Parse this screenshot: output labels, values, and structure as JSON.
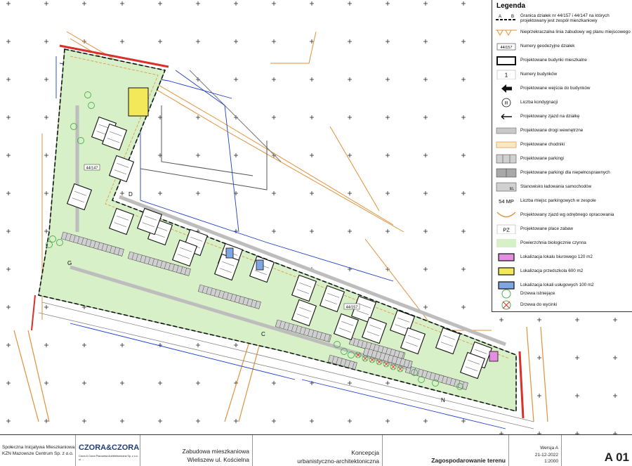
{
  "legend": {
    "title": "Legenda",
    "boundary_symbol_labels": [
      "A",
      "B"
    ],
    "parcel_number_sample": "44/157",
    "building_number_sample": "1",
    "storey_symbol_sample": "III",
    "charging_symbol_sample": "EL",
    "parking_count_sample": "54 MP",
    "playground_symbol_sample": "PZ",
    "items": [
      {
        "label": "Granica działek nr 44/157 i 44/147 na których projektowany jest zespół mieszkaniowy",
        "symbol": "boundary"
      },
      {
        "label": "Nieprzekraczalna linia zabudowy wg planu miejscowego",
        "symbol": "building-line"
      },
      {
        "label": "Numery geodezyjne działek",
        "symbol": "parcel-number"
      },
      {
        "label": "Projektowane budynki mieszkalne",
        "symbol": "building"
      },
      {
        "label": "Numery budynków",
        "symbol": "building-number"
      },
      {
        "label": "Projektowane wejścia do budynków",
        "symbol": "entrance-arrow"
      },
      {
        "label": "Liczba kondygnacji",
        "symbol": "storey-circle"
      },
      {
        "label": "Projektowany zjazd na działkę",
        "symbol": "access-arrow"
      },
      {
        "label": "Projektowane drogi wewnętrzne",
        "symbol": "road"
      },
      {
        "label": "Projektowane chodniki",
        "symbol": "sidewalk"
      },
      {
        "label": "Projektowane parkingi",
        "symbol": "parking"
      },
      {
        "label": "Projektowane parkingi dla niepełnosprawnych",
        "symbol": "parking-disabled"
      },
      {
        "label": "Stanowisko ładowania samochodów",
        "symbol": "charging"
      },
      {
        "label": "Liczba miejsc parkingowych w zespole",
        "symbol": "parking-count"
      },
      {
        "label": "Projektowany zjazd wg odrębnego opracowania",
        "symbol": "separate-access"
      },
      {
        "label": "Projektowane place zabaw",
        "symbol": "playground"
      },
      {
        "label": "Powierzchnia biologicznie czynna",
        "symbol": "green"
      },
      {
        "label": "Lokalizacja lokalu biurowego 120 m2",
        "symbol": "office"
      },
      {
        "label": "Lokalizacja przedszkola 600 m2",
        "symbol": "kindergarten"
      },
      {
        "label": "Lokalizacja lokali usługowych 100 m2",
        "symbol": "services"
      },
      {
        "label": "Drzewa istniejące",
        "symbol": "tree-existing"
      },
      {
        "label": "Drzewa do wycinki",
        "symbol": "tree-remove"
      }
    ]
  },
  "plan": {
    "parcel_labels": [
      "44/147",
      "44/157"
    ],
    "section_letters": [
      "D",
      "G",
      "C",
      "N"
    ]
  },
  "colors": {
    "green_area": "#d8f0c8",
    "office": "#e38ee0",
    "kindergarten": "#f2e85a",
    "services": "#7fa6e0",
    "boundary_red": "#d9302a",
    "utility_blue": "#1e3fc8",
    "orange_line": "#e0913a",
    "road_gray": "#c8c8c8",
    "tree_green": "#4caf50"
  },
  "title_block": {
    "investor_line1": "Społeczna Inicjatywa Mieszkaniowa",
    "investor_line2": "KZN Mazowsze Centrum Sp. z o.o.",
    "firm_logo": "CZORA&CZORA",
    "firm_details_line1": "Czora & Czora Pracownia Architektoniczna Sp. z o.o.",
    "firm_details_line2": "ul. ...",
    "project_line1": "Zabudowa mieszkaniowa",
    "project_line2": "Wieliszew ul. Kościelna",
    "stage_line1": "Koncepcja",
    "stage_line2": "urbanistyczno-architektoniczna",
    "drawing_title": "Zagospodarowanie terenu",
    "version": "Wersja A",
    "date": "21-12-2022",
    "scale": "1:2000",
    "sheet": "A 01"
  }
}
